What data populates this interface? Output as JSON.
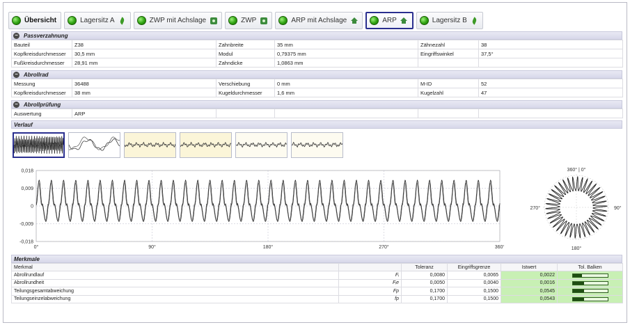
{
  "tabs": [
    {
      "label": "Übersicht",
      "icon": "",
      "active": false,
      "bold": true
    },
    {
      "label": "Lagersitz A",
      "icon": "leaf-icon",
      "active": false,
      "bold": false
    },
    {
      "label": "ZWP mit Achslage",
      "icon": "gear-icon",
      "active": false,
      "bold": false
    },
    {
      "label": "ZWP",
      "icon": "gear-icon",
      "active": false,
      "bold": false
    },
    {
      "label": "ARP mit Achslage",
      "icon": "house-icon",
      "active": false,
      "bold": false
    },
    {
      "label": "ARP",
      "icon": "house-icon",
      "active": true,
      "bold": false
    },
    {
      "label": "Lagersitz B",
      "icon": "leaf-icon",
      "active": false,
      "bold": false
    }
  ],
  "passverzahnung": {
    "title": "Passverzahnung",
    "rows": [
      [
        "Bauteil",
        "Z38",
        "Zahnbreite",
        "35 mm",
        "Zähnezahl",
        "38"
      ],
      [
        "Kopfkreisdurchmesser",
        "30,5 mm",
        "Modul",
        "0,79375 mm",
        "Eingriffswinkel",
        "37,5°"
      ],
      [
        "Fußkreisdurchmesser",
        "28,91 mm",
        "Zahndicke",
        "1,0863 mm",
        "",
        ""
      ]
    ]
  },
  "abrollrad": {
    "title": "Abrollrad",
    "rows": [
      [
        "Messung",
        "36488",
        "Verschiebung",
        "0 mm",
        "M-ID",
        "52"
      ],
      [
        "Kopfkreisdurchmesser",
        "38 mm",
        "Kugeldurchmesser",
        "1,6 mm",
        "Kugelzahl",
        "47"
      ]
    ]
  },
  "abrollpruefung": {
    "title": "Abrollprüfung",
    "rows": [
      [
        "Auswertung",
        "ARP",
        "",
        "",
        "",
        ""
      ]
    ]
  },
  "verlauf": {
    "title": "Verlauf"
  },
  "chart_data": {
    "type": "line",
    "x_ticks": [
      "0°",
      "90°",
      "180°",
      "270°",
      "360°"
    ],
    "y_ticks": [
      "0,018",
      "0,009",
      "0",
      "-0,009",
      "-0,018"
    ],
    "xlim": [
      0,
      360
    ],
    "ylim": [
      -0.018,
      0.018
    ],
    "teeth": 38,
    "peak_value": 0.0135,
    "trough_value": -0.01,
    "grid": true,
    "polar_labels": {
      "top": "360° | 0°",
      "right": "90°",
      "bottom": "180°",
      "left": "270°"
    }
  },
  "merkmale": {
    "title": "Merkmale",
    "headers": [
      "Merkmal",
      "",
      "Toleranz",
      "Eingriffsgrenze",
      "Istwert",
      "Tol. Balken"
    ],
    "rows": [
      {
        "name": "Abrollrundlauf",
        "symbol": "Fᵢ",
        "toleranz": "0,0080",
        "grenze": "0,0065",
        "ist": "0,0022",
        "fill": 0.275
      },
      {
        "name": "Abrollrundheit",
        "symbol": "Fᵢe",
        "toleranz": "0,0050",
        "grenze": "0,0040",
        "ist": "0,0016",
        "fill": 0.32
      },
      {
        "name": "Teilungsgesamtabweichung",
        "symbol": "Fp",
        "toleranz": "0,1700",
        "grenze": "0,1500",
        "ist": "0,0545",
        "fill": 0.32
      },
      {
        "name": "Teilungseinzelabweichung",
        "symbol": "fp",
        "toleranz": "0,1700",
        "grenze": "0,1500",
        "ist": "0,0543",
        "fill": 0.32
      }
    ]
  },
  "colors": {
    "accent": "#2a2f8f",
    "ok": "#2fa312",
    "ist_bg": "#c8f0b4"
  }
}
